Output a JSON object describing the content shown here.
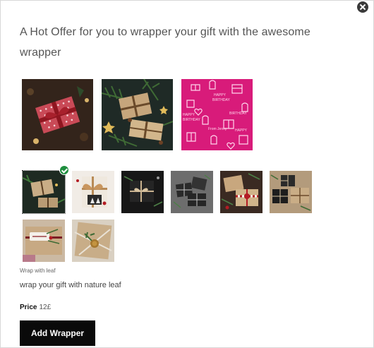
{
  "popup": {
    "heading": "A Hot Offer for you to wrapper your gift with the awesome wrapper",
    "close_icon": "close-icon"
  },
  "featured_wrappers": [
    {
      "name": "red-ribbon-present",
      "colors": [
        "#2a1e18",
        "#b32b34"
      ]
    },
    {
      "name": "kraft-paper-pine-branches",
      "colors": [
        "#1f2a26",
        "#c6a67c"
      ]
    },
    {
      "name": "pink-happy-birthday-paper",
      "colors": [
        "#d81b7a",
        "#ffd4ea"
      ]
    }
  ],
  "wrapper_options": [
    {
      "name": "wrap-with-leaf",
      "selected": true
    },
    {
      "name": "twine-bow-white"
    },
    {
      "name": "black-paper-twine"
    },
    {
      "name": "gray-boxes"
    },
    {
      "name": "red-white-ribbon"
    },
    {
      "name": "black-kraft-mix"
    },
    {
      "name": "label-tag-kraft"
    },
    {
      "name": "wax-seal-kraft"
    }
  ],
  "selected_wrapper": {
    "title": "Wrap with leaf",
    "description": "wrap your gift with nature leaf",
    "price_label": "Price",
    "price_value": "12£"
  },
  "actions": {
    "add_label": "Add Wrapper"
  }
}
